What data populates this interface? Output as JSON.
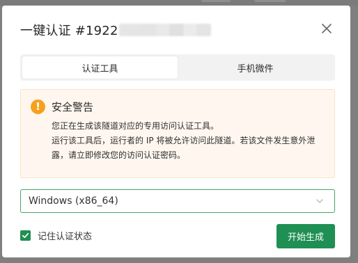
{
  "dialog": {
    "title": "一键认证 #1922",
    "close_icon": "close-icon"
  },
  "tabs": [
    {
      "label": "认证工具",
      "active": true
    },
    {
      "label": "手机微件",
      "active": false
    }
  ],
  "warning": {
    "icon": "warning-icon",
    "icon_glyph": "!",
    "title": "安全警告",
    "lines": [
      "您正在生成该隧道对应的专用访问认证工具。",
      "运行该工具后，运行者的 IP 将被允许访问此隧道。若该文件发生意外泄露，请立即修改您的访问认证密码。"
    ],
    "accent_color": "#f7a01d",
    "background_color": "#fff7ef"
  },
  "platform_select": {
    "value": "Windows (x86_64)",
    "chevron_icon": "chevron-down-icon"
  },
  "remember": {
    "checked": true,
    "label": "记住认证状态"
  },
  "actions": {
    "generate_label": "开始生成"
  },
  "colors": {
    "primary": "#1f8f53",
    "select_border": "#41a56c",
    "overlay": "#7f7f7f"
  }
}
